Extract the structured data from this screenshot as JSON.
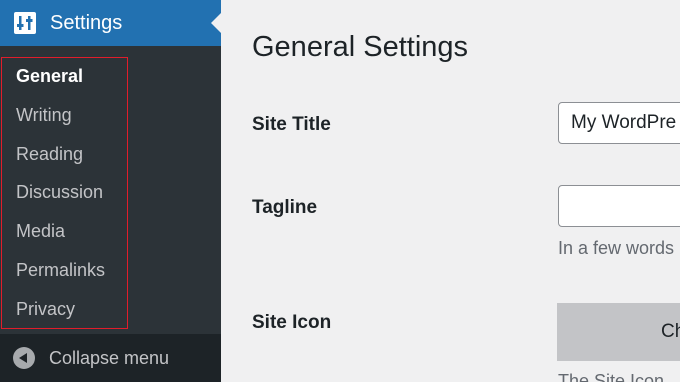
{
  "sidebar": {
    "menu_title": "Settings",
    "submenu": [
      {
        "label": "General",
        "current": true
      },
      {
        "label": "Writing",
        "current": false
      },
      {
        "label": "Reading",
        "current": false
      },
      {
        "label": "Discussion",
        "current": false
      },
      {
        "label": "Media",
        "current": false
      },
      {
        "label": "Permalinks",
        "current": false
      },
      {
        "label": "Privacy",
        "current": false
      }
    ],
    "collapse_label": "Collapse menu"
  },
  "main": {
    "page_title": "General Settings",
    "site_title": {
      "label": "Site Title",
      "value": "My WordPre"
    },
    "tagline": {
      "label": "Tagline",
      "value": "",
      "description": "In a few words"
    },
    "site_icon": {
      "label": "Site Icon",
      "button_label": "Ch",
      "description": "The Site Icon"
    }
  },
  "colors": {
    "sidebar_bg": "#2c3338",
    "active_menu_bg": "#2271b1",
    "highlight_border": "#e11d2b",
    "page_bg": "#f0f0f1"
  }
}
